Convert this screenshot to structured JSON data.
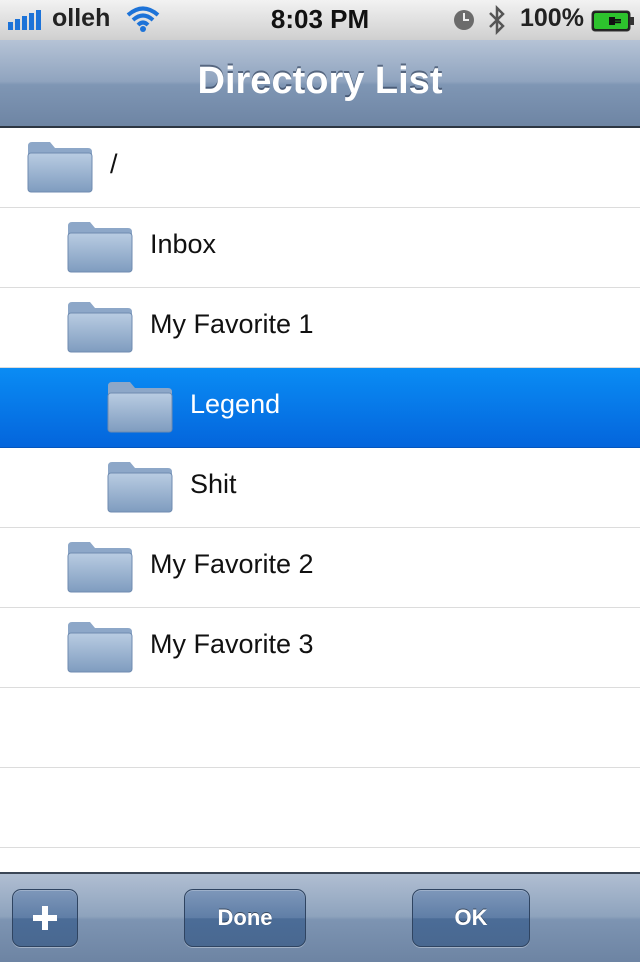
{
  "status_bar": {
    "carrier": "olleh",
    "time": "8:03 PM",
    "battery": "100%",
    "icons": [
      "signal-icon",
      "wifi-icon",
      "clock-icon",
      "bluetooth-icon",
      "battery-icon"
    ]
  },
  "nav": {
    "title": "Directory List"
  },
  "list": {
    "items": [
      {
        "label": "/",
        "level": 0,
        "selected": false,
        "icon": "folder-icon"
      },
      {
        "label": "Inbox",
        "level": 1,
        "selected": false,
        "icon": "folder-icon"
      },
      {
        "label": "My Favorite 1",
        "level": 1,
        "selected": false,
        "icon": "folder-icon"
      },
      {
        "label": "Legend",
        "level": 2,
        "selected": true,
        "icon": "folder-icon"
      },
      {
        "label": "Shit",
        "level": 2,
        "selected": false,
        "icon": "folder-icon"
      },
      {
        "label": "My Favorite 2",
        "level": 1,
        "selected": false,
        "icon": "folder-icon"
      },
      {
        "label": "My Favorite 3",
        "level": 1,
        "selected": false,
        "icon": "folder-icon"
      }
    ]
  },
  "toolbar": {
    "add_icon": "plus-icon",
    "done_label": "Done",
    "ok_label": "OK"
  },
  "colors": {
    "selected_row": "#0a7ae8",
    "nav_bar": "#8ea3bd",
    "toolbar_button": "#5f7ea6"
  }
}
